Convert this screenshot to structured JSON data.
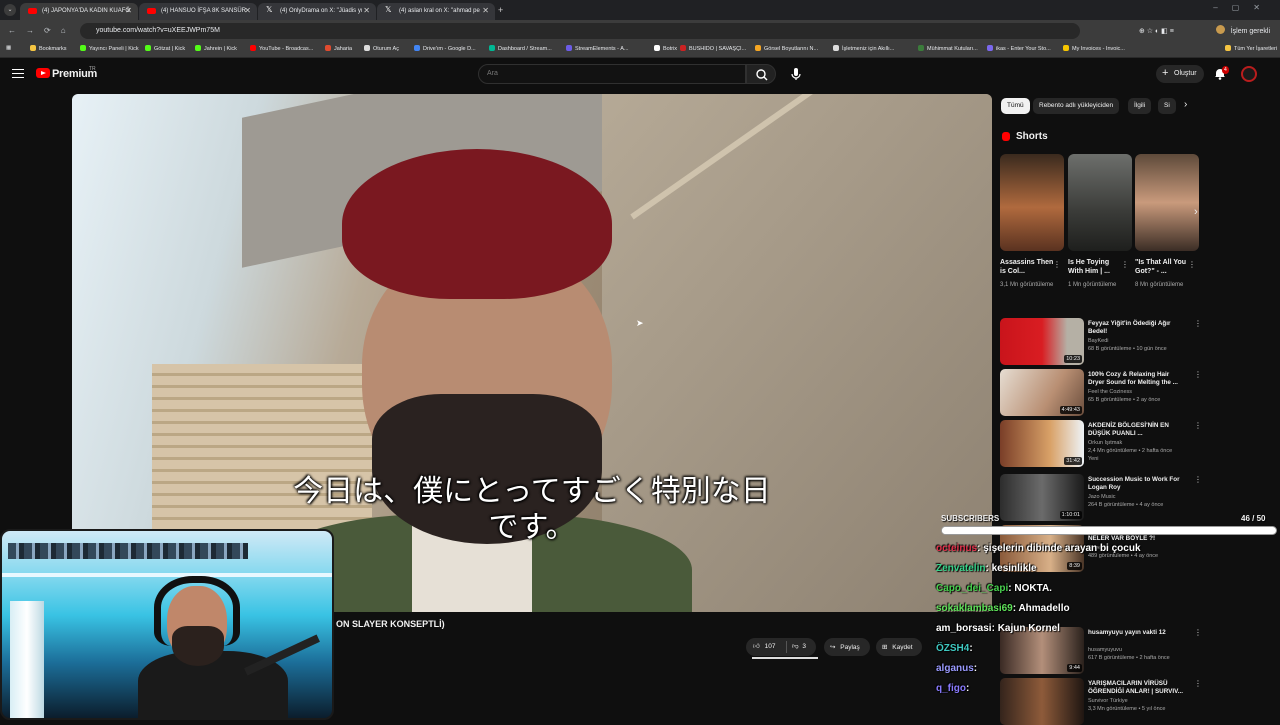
{
  "browser": {
    "tabs": [
      {
        "label": "(4) JAPONYA'DA KADIN KUAFÖ",
        "icon": "youtube-icon",
        "active": true
      },
      {
        "label": "(4) HANSUO İFŞA 8K SANSÜR",
        "icon": "youtube-icon",
        "active": false
      },
      {
        "label": "(4) OnlyDrama on X: \"Jüadis yı",
        "icon": "x-icon",
        "active": false
      },
      {
        "label": "(4) aslan kral on X: \"ahmad pe",
        "icon": "x-icon",
        "active": false
      }
    ],
    "url": "youtube.com/watch?v=uXEEJWPm75M",
    "profile_label": "İşlem gerekli",
    "bookmarks": [
      "Bookmarks",
      "Yayıncı Paneli | Kick",
      "Götzat | Kick",
      "Jahrein | Kick",
      "YouTube - Broadcas...",
      "Jaharia",
      "Oturum Aç",
      "Drive'ım - Google D...",
      "Dashboard / Stream...",
      "StreamElements - A...",
      "Botrix",
      "BUSHIDO | SAVAŞÇI...",
      "Görsel Boyutlarını N...",
      "İşletmeniz için Akıllı...",
      "Mühimmat Kutuları...",
      "ikas - Enter Your Sto...",
      "My Invoices - Invoic...",
      "Tüm Yer İşaretleri"
    ]
  },
  "yt": {
    "brand": "Premium",
    "country": "TR",
    "search_placeholder": "Ara",
    "create_label": "Oluştur",
    "notification_count": "4"
  },
  "video": {
    "subtitle_line1": "今日は、僕にとってすごく特別な日",
    "subtitle_line2": "です。",
    "title_fragment": "ON SLAYER KONSEPTLİ)",
    "likes": "107",
    "dislikes": "3",
    "share_label": "Paylaş",
    "save_label": "Kaydet"
  },
  "sidebar": {
    "chips": [
      "Tümü",
      "Rebento adlı yükleyiciden",
      "İlgili",
      "Si"
    ],
    "shorts_heading": "Shorts",
    "shorts": [
      {
        "title": "Assassins Then is Col...",
        "views": "3,1 Mn görüntüleme"
      },
      {
        "title": "Is He Toying With Him | ...",
        "views": "1 Mn görüntüleme"
      },
      {
        "title": "\"Is That All You Got?\" - ...",
        "views": "8 Mn görüntüleme"
      }
    ],
    "recommendations": [
      {
        "title": "Feyyaz Yiğit'in Ödediği Ağır Bedel!",
        "channel": "BayKedi",
        "meta": "68 B görüntüleme • 10 gün önce",
        "duration": "10:23"
      },
      {
        "title": "100% Cozy & Relaxing Hair Dryer Sound for Melting the ...",
        "channel": "Feel the Coziness",
        "meta": "65 B görüntüleme • 2 ay önce",
        "duration": "4:49:43"
      },
      {
        "title": "AKDENİZ BÖLGESİ'NİN EN DÜŞÜK PUANLI ...",
        "channel": "Orkun Işıtmak",
        "meta": "2,4 Mn görüntüleme • 2 hafta önce",
        "duration": "31:42",
        "extra": "Yeni"
      },
      {
        "title": "Succession Music to Work For Logan Roy",
        "channel": "Jazo Music",
        "meta": "264 B görüntüleme • 4 ay önce",
        "duration": "1:10:01"
      },
      {
        "title": "JAPON SOKAK FESTİVALİNDE NELER VAR BÖYLE ?!",
        "channel": "Rebento",
        "meta": "489 görüntüleme • 4 ay önce",
        "duration": "8:39"
      },
      {
        "title": "husamyuyu yayın vakti 12",
        "channel": "husamyuyuvu",
        "meta": "617 B görüntüleme • 2 hafta önce",
        "duration": "9:44"
      },
      {
        "title": "YARIŞMACILARIN VİRÜSÜ ÖĞRENDİĞİ ANLAR! | SURVIV...",
        "channel": "Survivor Türkiye",
        "meta": "3,3 Mn görüntüleme • 5 yıl önce",
        "duration": ""
      }
    ]
  },
  "overlay": {
    "subs_label": "SUBSCRIBERS",
    "subs_count": "46  / 50",
    "subs_progress": 0.92,
    "chat": [
      {
        "user": "octeinus",
        "color": "#e0304a",
        "message": ": şişelerin dibinde arayan bi çocuk"
      },
      {
        "user": "Zenvatelin",
        "color": "#36d48a",
        "message": ": kesinlikle"
      },
      {
        "user": "Capo_dei_Capi",
        "color": "#48d14f",
        "message": ": NOKTA."
      },
      {
        "user": "sokaklambasi69",
        "color": "#5fe35a",
        "message": ": Ahmadello"
      },
      {
        "user": "am_borsasi",
        "color": "#ffffff",
        "message": ": Kajun Kornel"
      },
      {
        "user": "ÖZSH4",
        "color": "#3fc8c0",
        "message": ":"
      },
      {
        "user": "alganus",
        "color": "#9a9aff",
        "message": ":"
      },
      {
        "user": "q_figo",
        "color": "#8a7bff",
        "message": ":"
      }
    ]
  }
}
